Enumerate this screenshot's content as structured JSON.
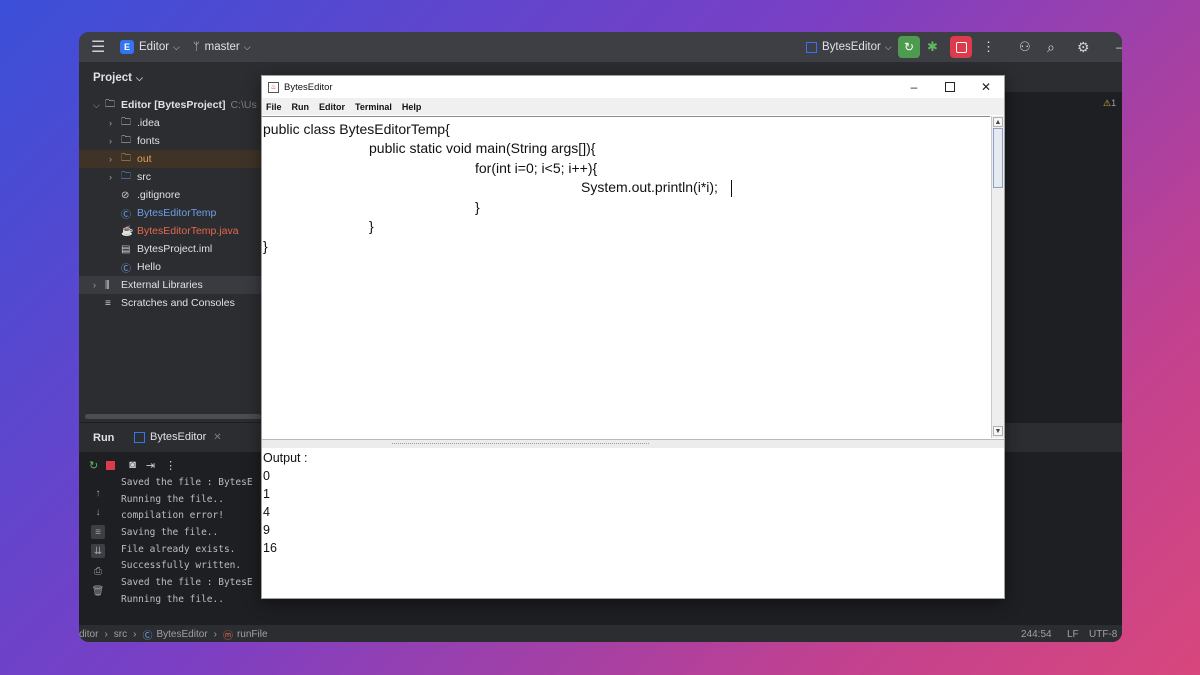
{
  "ide": {
    "project_badge": "E",
    "project_name": "Editor",
    "branch": "master",
    "run_config": "BytesEditor",
    "project_pane_title": "Project",
    "tree": [
      {
        "label": "Editor [BytesProject]",
        "suffix": "C:\\Us",
        "color": "#dfe1e5",
        "bold": true
      },
      {
        "label": ".idea",
        "color": "#dfe1e5"
      },
      {
        "label": "fonts",
        "color": "#dfe1e5"
      },
      {
        "label": "out",
        "color": "#d9a35b"
      },
      {
        "label": "src",
        "color": "#dfe1e5"
      },
      {
        "label": ".gitignore",
        "color": "#dfe1e5"
      },
      {
        "label": "BytesEditorTemp",
        "color": "#6f9fe8"
      },
      {
        "label": "BytesEditorTemp.java",
        "color": "#e5684f"
      },
      {
        "label": "BytesProject.iml",
        "color": "#dfe1e5"
      },
      {
        "label": "Hello",
        "color": "#dfe1e5"
      },
      {
        "label": "External Libraries",
        "color": "#dfe1e5"
      },
      {
        "label": "Scratches and Consoles",
        "color": "#dfe1e5"
      }
    ],
    "run_tab": "Run",
    "run_config_tab": "BytesEditor",
    "run_log": [
      "Saved the file : BytesE",
      "Running the file..",
      "compilation error!",
      "Saving the file..",
      "File already exists.",
      "Successfully written.",
      "Saved the file : BytesE",
      "Running the file.."
    ],
    "breadcrumb": [
      "ditor",
      "src",
      "BytesEditor",
      "runFile"
    ],
    "cursor_position": "244:54",
    "line_ending": "LF",
    "encoding": "UTF-8",
    "warning_count": "1",
    "colors": {
      "accent": "#3574f0",
      "run_green": "#4e9a4e",
      "stop_red": "#db3b4b"
    }
  },
  "app_window": {
    "title": "BytesEditor",
    "menu": [
      "File",
      "Run",
      "Editor",
      "Terminal",
      "Help"
    ],
    "code_lines": [
      "public class BytesEditorTemp{",
      "public static void main(String args[]){",
      "for(int i=0; i<5; i++){",
      "System.out.println(i*i);",
      "}",
      "}",
      "}"
    ],
    "output_label": "Output :",
    "output_lines": [
      "0",
      "1",
      "4",
      "9",
      "16"
    ]
  }
}
